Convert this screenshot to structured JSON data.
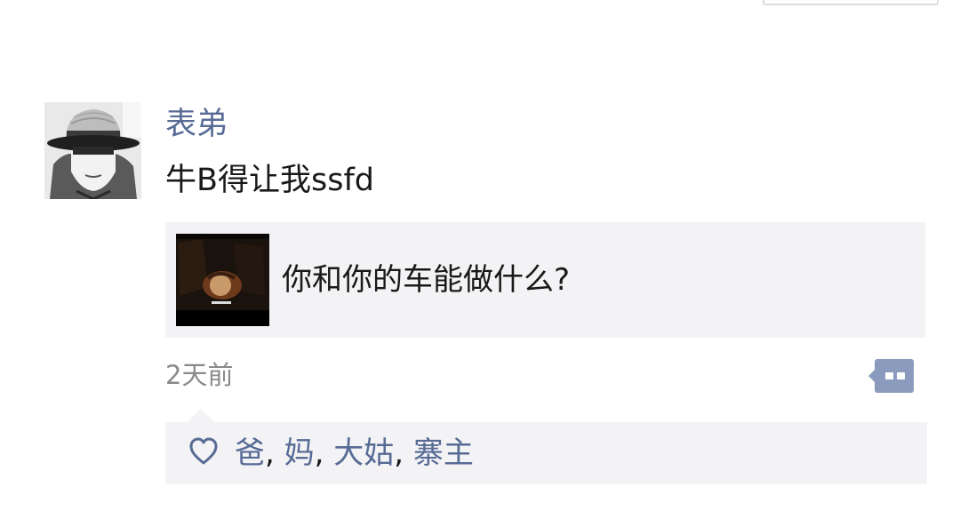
{
  "post": {
    "author": "表弟",
    "text": "牛B得让我ssfd",
    "timestamp": "2天前"
  },
  "link_card": {
    "title": "你和你的车能做什么?"
  },
  "likes": {
    "users": [
      "爸",
      "妈",
      "大姑",
      "寨主"
    ],
    "separator": ", "
  },
  "icons": {
    "like": "heart-outline-icon",
    "comment": "comment-dots-icon"
  },
  "colors": {
    "name": "#576b95",
    "text": "#191919",
    "meta": "#8a8a8a",
    "panel": "#f3f3f5",
    "comment_button": "#8a9bbd"
  }
}
